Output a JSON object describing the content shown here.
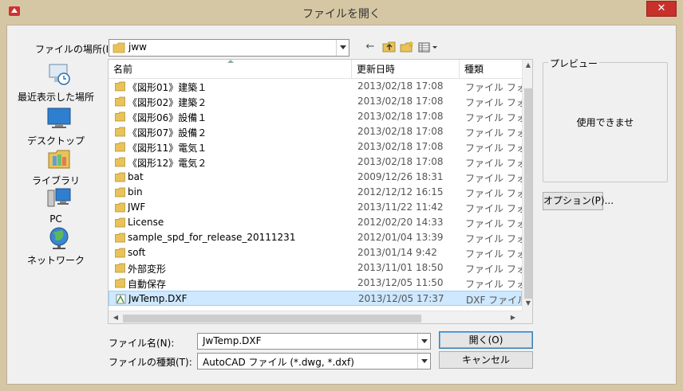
{
  "window": {
    "title": "ファイルを開く",
    "close_glyph": "✕"
  },
  "location": {
    "label": "ファイルの場所(I):",
    "value": "jww"
  },
  "places": [
    {
      "label": "最近表示した場所",
      "icon": "recent-places-icon"
    },
    {
      "label": "デスクトップ",
      "icon": "desktop-icon"
    },
    {
      "label": "ライブラリ",
      "icon": "libraries-icon"
    },
    {
      "label": "PC",
      "icon": "computer-icon"
    },
    {
      "label": "ネットワーク",
      "icon": "network-icon"
    }
  ],
  "columns": {
    "name": "名前",
    "date": "更新日時",
    "type": "種類"
  },
  "files": [
    {
      "name": "《図形01》建築１",
      "date": "2013/02/18 17:08",
      "type": "ファイル フォルダー",
      "kind": "folder"
    },
    {
      "name": "《図形02》建築２",
      "date": "2013/02/18 17:08",
      "type": "ファイル フォルダー",
      "kind": "folder"
    },
    {
      "name": "《図形06》設備１",
      "date": "2013/02/18 17:08",
      "type": "ファイル フォルダー",
      "kind": "folder"
    },
    {
      "name": "《図形07》設備２",
      "date": "2013/02/18 17:08",
      "type": "ファイル フォルダー",
      "kind": "folder"
    },
    {
      "name": "《図形11》電気１",
      "date": "2013/02/18 17:08",
      "type": "ファイル フォルダー",
      "kind": "folder"
    },
    {
      "name": "《図形12》電気２",
      "date": "2013/02/18 17:08",
      "type": "ファイル フォルダー",
      "kind": "folder"
    },
    {
      "name": "bat",
      "date": "2009/12/26 18:31",
      "type": "ファイル フォルダー",
      "kind": "folder"
    },
    {
      "name": "bin",
      "date": "2012/12/12 16:15",
      "type": "ファイル フォルダー",
      "kind": "folder"
    },
    {
      "name": "JWF",
      "date": "2013/11/22 11:42",
      "type": "ファイル フォルダー",
      "kind": "folder"
    },
    {
      "name": "License",
      "date": "2012/02/20 14:33",
      "type": "ファイル フォルダー",
      "kind": "folder"
    },
    {
      "name": "sample_spd_for_release_20111231",
      "date": "2012/01/04 13:39",
      "type": "ファイル フォルダー",
      "kind": "folder"
    },
    {
      "name": "soft",
      "date": "2013/01/14 9:42",
      "type": "ファイル フォルダー",
      "kind": "folder"
    },
    {
      "name": "外部変形",
      "date": "2013/11/01 18:50",
      "type": "ファイル フォルダー",
      "kind": "folder"
    },
    {
      "name": "自動保存",
      "date": "2013/12/05 11:50",
      "type": "ファイル フォルダー",
      "kind": "folder"
    },
    {
      "name": "JwTemp.DXF",
      "date": "2013/12/05 17:37",
      "type": "DXF ファイル",
      "kind": "dxf",
      "selected": true
    }
  ],
  "preview": {
    "title": "プレビュー",
    "message": "使用できませ"
  },
  "options_button": "オプション(P)...",
  "filename": {
    "label": "ファイル名(N):",
    "value": "JwTemp.DXF"
  },
  "filetype": {
    "label": "ファイルの種類(T):",
    "value": "AutoCAD ファイル (*.dwg, *.dxf)"
  },
  "open_button": "開く(O)",
  "cancel_button": "キャンセル",
  "colors": {
    "title_bar": "#d6c7a4",
    "close_button": "#c7302b",
    "selection": "#cde8ff",
    "folder": "#e8c35a"
  }
}
